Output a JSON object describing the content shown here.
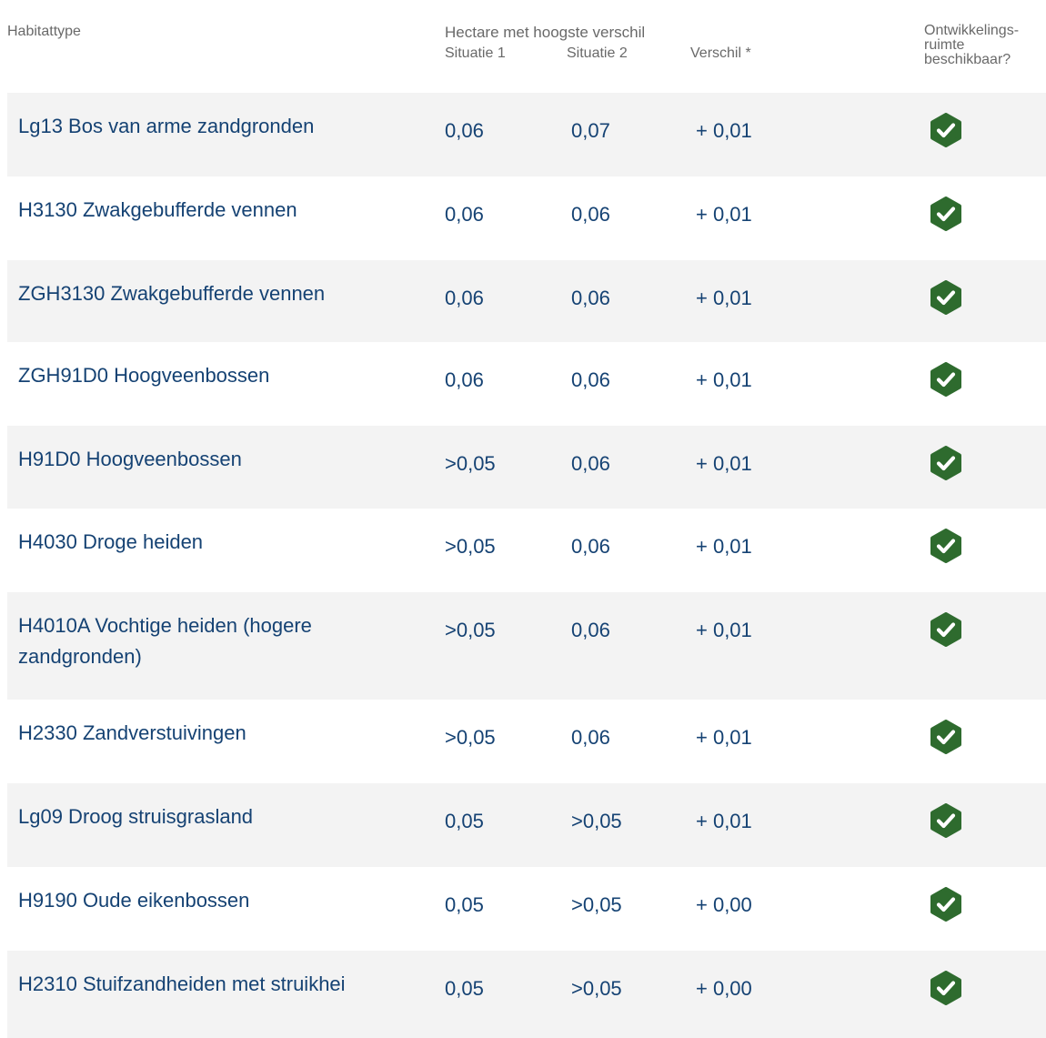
{
  "header": {
    "habitat_label": "Habitattype",
    "group_label": "Hectare met hoogste verschil",
    "situation1_label": "Situatie 1",
    "situation2_label": "Situatie 2",
    "difference_label": "Verschil *",
    "development_line1": "Ontwikkelings-",
    "development_line2": "ruimte",
    "development_line3": "beschikbaar?"
  },
  "colors": {
    "text": "#154273",
    "header_text": "#696969",
    "row_alt": "#f3f3f3",
    "check": "#2e6b2e"
  },
  "rows": [
    {
      "name": "Lg13 Bos van arme zandgronden",
      "s1": "0,06",
      "s2": "0,07",
      "diff": "+ 0,01",
      "available_icon": "check-badge-icon"
    },
    {
      "name": "H3130 Zwakgebufferde vennen",
      "s1": "0,06",
      "s2": "0,06",
      "diff": "+ 0,01",
      "available_icon": "check-badge-icon"
    },
    {
      "name": "ZGH3130 Zwakgebufferde vennen",
      "s1": "0,06",
      "s2": "0,06",
      "diff": "+ 0,01",
      "available_icon": "check-badge-icon"
    },
    {
      "name": "ZGH91D0 Hoogveenbossen",
      "s1": "0,06",
      "s2": "0,06",
      "diff": "+ 0,01",
      "available_icon": "check-badge-icon"
    },
    {
      "name": "H91D0 Hoogveenbossen",
      "s1": ">0,05",
      "s2": "0,06",
      "diff": "+ 0,01",
      "available_icon": "check-badge-icon"
    },
    {
      "name": "H4030 Droge heiden",
      "s1": ">0,05",
      "s2": "0,06",
      "diff": "+ 0,01",
      "available_icon": "check-badge-icon"
    },
    {
      "name": "H4010A Vochtige heiden (hogere zandgronden)",
      "s1": ">0,05",
      "s2": "0,06",
      "diff": "+ 0,01",
      "available_icon": "check-badge-icon"
    },
    {
      "name": "H2330 Zandverstuivingen",
      "s1": ">0,05",
      "s2": "0,06",
      "diff": "+ 0,01",
      "available_icon": "check-badge-icon"
    },
    {
      "name": "Lg09 Droog struisgrasland",
      "s1": "0,05",
      "s2": ">0,05",
      "diff": "+ 0,01",
      "available_icon": "check-badge-icon"
    },
    {
      "name": "H9190 Oude eikenbossen",
      "s1": "0,05",
      "s2": ">0,05",
      "diff": "+ 0,00",
      "available_icon": "check-badge-icon"
    },
    {
      "name": "H2310 Stuifzandheiden met struikhei",
      "s1": "0,05",
      "s2": ">0,05",
      "diff": "+ 0,00",
      "available_icon": "check-badge-icon"
    }
  ]
}
